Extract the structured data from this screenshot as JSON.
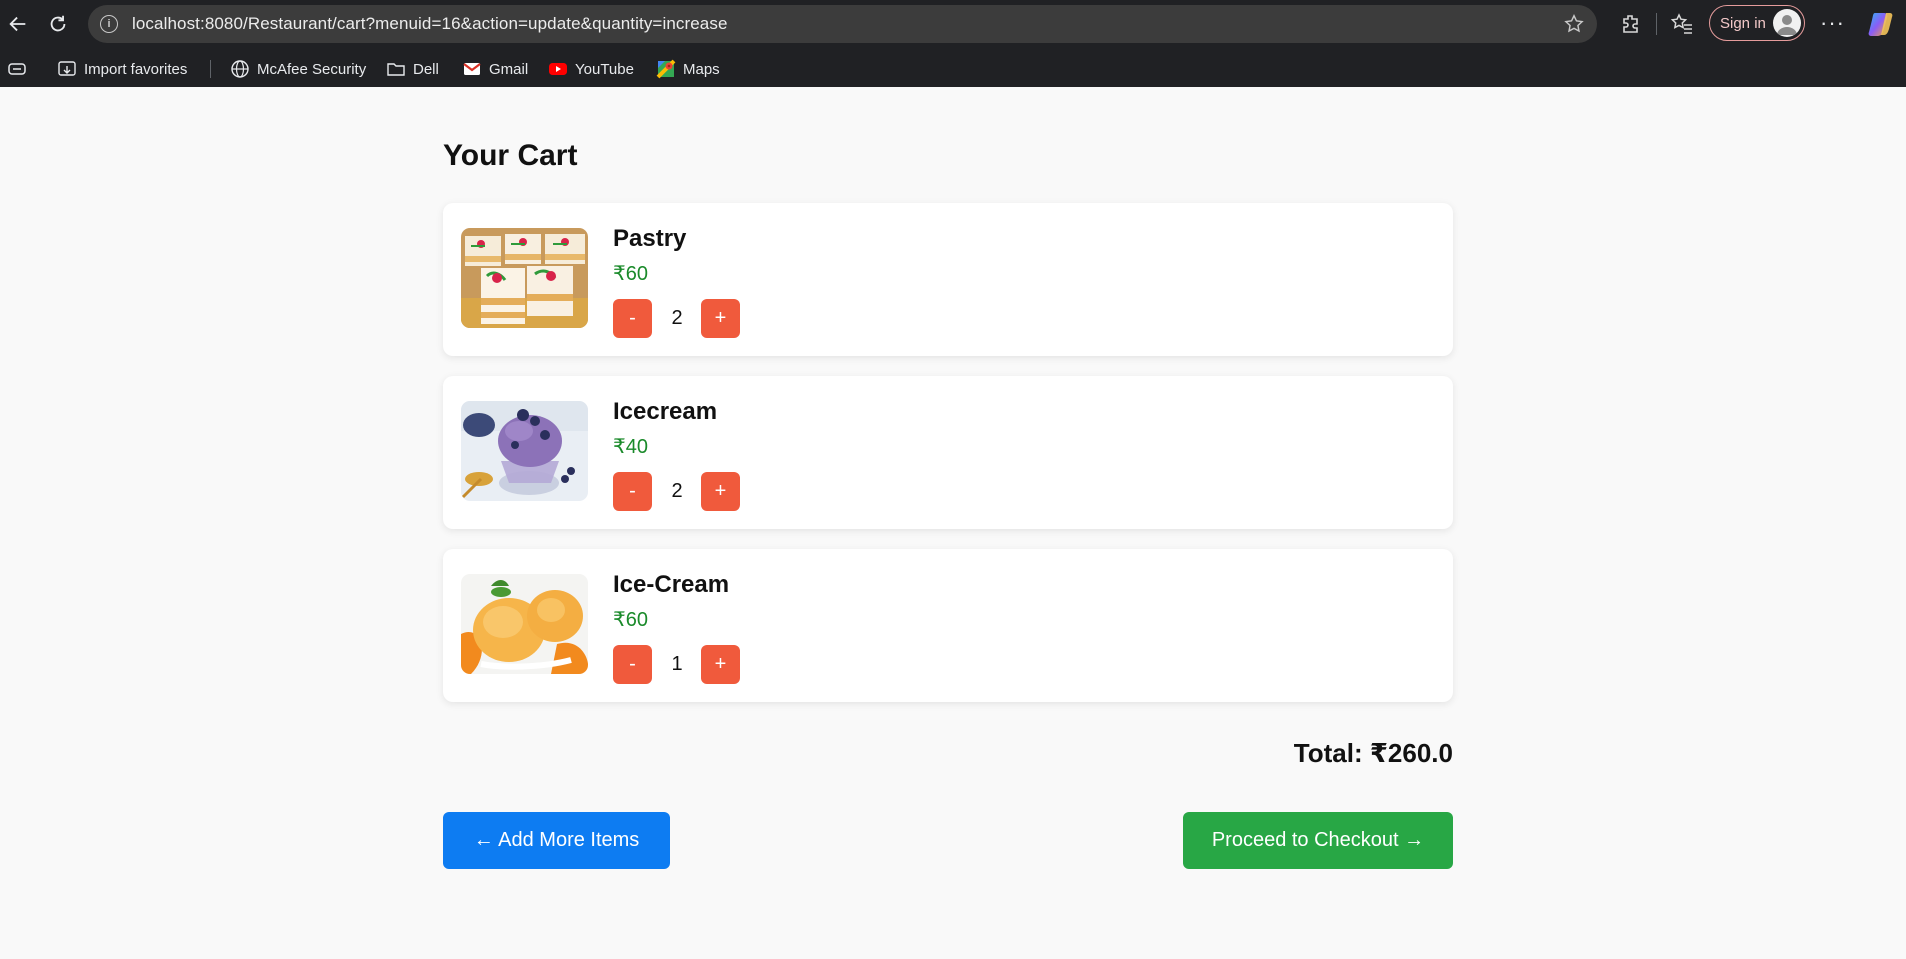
{
  "browser": {
    "url": "localhost:8080/Restaurant/cart?menuid=16&action=update&quantity=increase",
    "signin_label": "Sign in",
    "bookmarks": [
      {
        "label": "Import favorites",
        "icon": "import-icon"
      },
      {
        "label": "McAfee Security",
        "icon": "globe-icon"
      },
      {
        "label": "Dell",
        "icon": "folder-icon"
      },
      {
        "label": "Gmail",
        "icon": "gmail-icon"
      },
      {
        "label": "YouTube",
        "icon": "youtube-icon"
      },
      {
        "label": "Maps",
        "icon": "maps-icon"
      }
    ]
  },
  "cart": {
    "title": "Your Cart",
    "items": [
      {
        "name": "Pastry",
        "price": "₹60",
        "quantity": "2",
        "minus_label": "-",
        "plus_label": "+",
        "image": "pastry-image"
      },
      {
        "name": "Icecream",
        "price": "₹40",
        "quantity": "2",
        "minus_label": "-",
        "plus_label": "+",
        "image": "blueberry-icecream-image"
      },
      {
        "name": "Ice-Cream",
        "price": "₹60",
        "quantity": "1",
        "minus_label": "-",
        "plus_label": "+",
        "image": "mango-icecream-image"
      }
    ],
    "total": "Total: ₹260.0",
    "add_more_label": "← Add More Items",
    "checkout_label": "Proceed to Checkout →"
  },
  "colors": {
    "qty_button": "#f05a3c",
    "price": "#1a8a2a",
    "add_more_button": "#0d7cf2",
    "checkout_button": "#28a745"
  }
}
